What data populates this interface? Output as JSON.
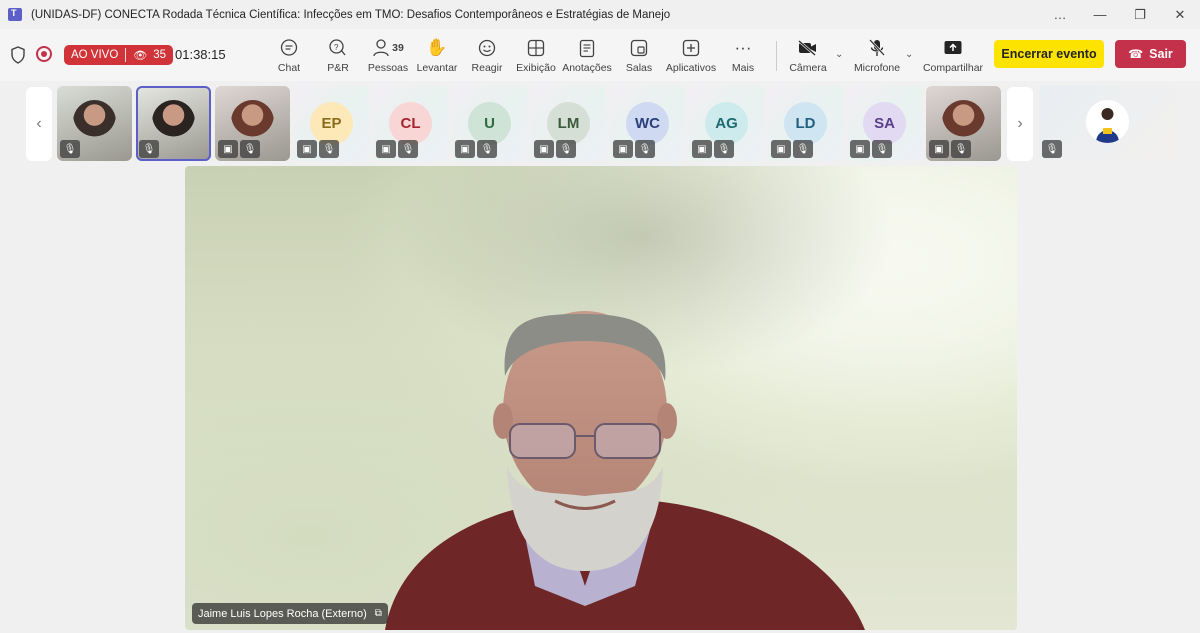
{
  "window": {
    "title": "(UNIDAS-DF) CONECTA Rodada Técnica Científica: Infecções em TMO: Desafios Contemporâneos e Estratégias de Manejo",
    "controls": [
      "…",
      "—",
      "❐",
      "✕"
    ]
  },
  "meeting": {
    "live_label": "AO VIVO",
    "viewers": "35",
    "timer": "01:38:15"
  },
  "toolbar": {
    "chat": "Chat",
    "qa": "P&R",
    "people": "Pessoas",
    "people_count": "39",
    "raise": "Levantar",
    "react": "Reagir",
    "view": "Exibição",
    "notes": "Anotações",
    "rooms": "Salas",
    "apps": "Aplicativos",
    "more": "Mais",
    "camera": "Câmera",
    "mic": "Microfone",
    "share": "Compartilhar",
    "end_event": "Encerrar evento",
    "leave": "Sair"
  },
  "participants": [
    {
      "type": "photo",
      "initials": ""
    },
    {
      "type": "photo",
      "initials": ""
    },
    {
      "type": "photo",
      "initials": ""
    },
    {
      "type": "avatar",
      "initials": "EP",
      "bg": "#fde8b8",
      "fg": "#8a6d1a"
    },
    {
      "type": "avatar",
      "initials": "CL",
      "bg": "#f9d6d6",
      "fg": "#a4262c"
    },
    {
      "type": "avatar",
      "initials": "U",
      "bg": "#cfe3d6",
      "fg": "#2e6b45"
    },
    {
      "type": "avatar",
      "initials": "LM",
      "bg": "#d6dfd6",
      "fg": "#3d5a3d"
    },
    {
      "type": "avatar",
      "initials": "WC",
      "bg": "#cfd9f2",
      "fg": "#2b3f7a"
    },
    {
      "type": "avatar",
      "initials": "AG",
      "bg": "#cdeaec",
      "fg": "#1f6a70"
    },
    {
      "type": "avatar",
      "initials": "LD",
      "bg": "#cfe5f2",
      "fg": "#21607f"
    },
    {
      "type": "avatar",
      "initials": "SA",
      "bg": "#e2d9f2",
      "fg": "#5a3f8a"
    },
    {
      "type": "photo",
      "initials": ""
    }
  ],
  "speaker": {
    "name": "Jaime Luis Lopes Rocha (Externo)"
  }
}
